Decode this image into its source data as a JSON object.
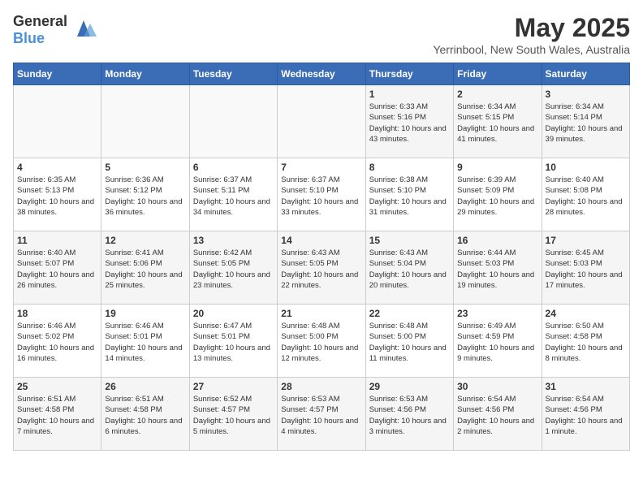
{
  "header": {
    "logo_general": "General",
    "logo_blue": "Blue",
    "month_year": "May 2025",
    "location": "Yerrinbool, New South Wales, Australia"
  },
  "days_of_week": [
    "Sunday",
    "Monday",
    "Tuesday",
    "Wednesday",
    "Thursday",
    "Friday",
    "Saturday"
  ],
  "weeks": [
    [
      {
        "day": "",
        "info": ""
      },
      {
        "day": "",
        "info": ""
      },
      {
        "day": "",
        "info": ""
      },
      {
        "day": "",
        "info": ""
      },
      {
        "day": "1",
        "info": "Sunrise: 6:33 AM\nSunset: 5:16 PM\nDaylight: 10 hours\nand 43 minutes."
      },
      {
        "day": "2",
        "info": "Sunrise: 6:34 AM\nSunset: 5:15 PM\nDaylight: 10 hours\nand 41 minutes."
      },
      {
        "day": "3",
        "info": "Sunrise: 6:34 AM\nSunset: 5:14 PM\nDaylight: 10 hours\nand 39 minutes."
      }
    ],
    [
      {
        "day": "4",
        "info": "Sunrise: 6:35 AM\nSunset: 5:13 PM\nDaylight: 10 hours\nand 38 minutes."
      },
      {
        "day": "5",
        "info": "Sunrise: 6:36 AM\nSunset: 5:12 PM\nDaylight: 10 hours\nand 36 minutes."
      },
      {
        "day": "6",
        "info": "Sunrise: 6:37 AM\nSunset: 5:11 PM\nDaylight: 10 hours\nand 34 minutes."
      },
      {
        "day": "7",
        "info": "Sunrise: 6:37 AM\nSunset: 5:10 PM\nDaylight: 10 hours\nand 33 minutes."
      },
      {
        "day": "8",
        "info": "Sunrise: 6:38 AM\nSunset: 5:10 PM\nDaylight: 10 hours\nand 31 minutes."
      },
      {
        "day": "9",
        "info": "Sunrise: 6:39 AM\nSunset: 5:09 PM\nDaylight: 10 hours\nand 29 minutes."
      },
      {
        "day": "10",
        "info": "Sunrise: 6:40 AM\nSunset: 5:08 PM\nDaylight: 10 hours\nand 28 minutes."
      }
    ],
    [
      {
        "day": "11",
        "info": "Sunrise: 6:40 AM\nSunset: 5:07 PM\nDaylight: 10 hours\nand 26 minutes."
      },
      {
        "day": "12",
        "info": "Sunrise: 6:41 AM\nSunset: 5:06 PM\nDaylight: 10 hours\nand 25 minutes."
      },
      {
        "day": "13",
        "info": "Sunrise: 6:42 AM\nSunset: 5:05 PM\nDaylight: 10 hours\nand 23 minutes."
      },
      {
        "day": "14",
        "info": "Sunrise: 6:43 AM\nSunset: 5:05 PM\nDaylight: 10 hours\nand 22 minutes."
      },
      {
        "day": "15",
        "info": "Sunrise: 6:43 AM\nSunset: 5:04 PM\nDaylight: 10 hours\nand 20 minutes."
      },
      {
        "day": "16",
        "info": "Sunrise: 6:44 AM\nSunset: 5:03 PM\nDaylight: 10 hours\nand 19 minutes."
      },
      {
        "day": "17",
        "info": "Sunrise: 6:45 AM\nSunset: 5:03 PM\nDaylight: 10 hours\nand 17 minutes."
      }
    ],
    [
      {
        "day": "18",
        "info": "Sunrise: 6:46 AM\nSunset: 5:02 PM\nDaylight: 10 hours\nand 16 minutes."
      },
      {
        "day": "19",
        "info": "Sunrise: 6:46 AM\nSunset: 5:01 PM\nDaylight: 10 hours\nand 14 minutes."
      },
      {
        "day": "20",
        "info": "Sunrise: 6:47 AM\nSunset: 5:01 PM\nDaylight: 10 hours\nand 13 minutes."
      },
      {
        "day": "21",
        "info": "Sunrise: 6:48 AM\nSunset: 5:00 PM\nDaylight: 10 hours\nand 12 minutes."
      },
      {
        "day": "22",
        "info": "Sunrise: 6:48 AM\nSunset: 5:00 PM\nDaylight: 10 hours\nand 11 minutes."
      },
      {
        "day": "23",
        "info": "Sunrise: 6:49 AM\nSunset: 4:59 PM\nDaylight: 10 hours\nand 9 minutes."
      },
      {
        "day": "24",
        "info": "Sunrise: 6:50 AM\nSunset: 4:58 PM\nDaylight: 10 hours\nand 8 minutes."
      }
    ],
    [
      {
        "day": "25",
        "info": "Sunrise: 6:51 AM\nSunset: 4:58 PM\nDaylight: 10 hours\nand 7 minutes."
      },
      {
        "day": "26",
        "info": "Sunrise: 6:51 AM\nSunset: 4:58 PM\nDaylight: 10 hours\nand 6 minutes."
      },
      {
        "day": "27",
        "info": "Sunrise: 6:52 AM\nSunset: 4:57 PM\nDaylight: 10 hours\nand 5 minutes."
      },
      {
        "day": "28",
        "info": "Sunrise: 6:53 AM\nSunset: 4:57 PM\nDaylight: 10 hours\nand 4 minutes."
      },
      {
        "day": "29",
        "info": "Sunrise: 6:53 AM\nSunset: 4:56 PM\nDaylight: 10 hours\nand 3 minutes."
      },
      {
        "day": "30",
        "info": "Sunrise: 6:54 AM\nSunset: 4:56 PM\nDaylight: 10 hours\nand 2 minutes."
      },
      {
        "day": "31",
        "info": "Sunrise: 6:54 AM\nSunset: 4:56 PM\nDaylight: 10 hours\nand 1 minute."
      }
    ]
  ]
}
